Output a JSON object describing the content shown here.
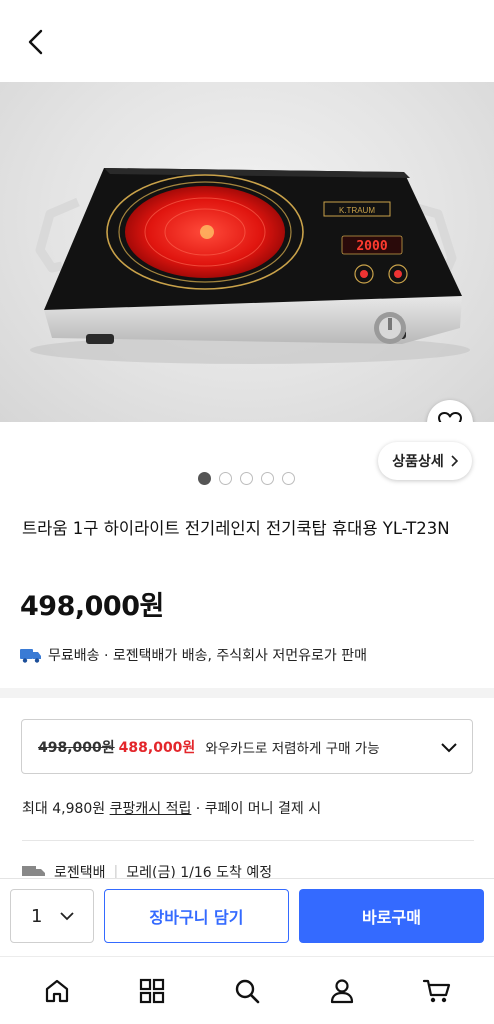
{
  "header": {
    "back_icon": "chevron-left-icon"
  },
  "product": {
    "image_icon": "induction-cooktop-photo",
    "hob_display": "2000",
    "hob_brand": "K.TRAUM",
    "title": "트라움 1구 하이라이트 전기레인지 전기쿡탑 휴대용 YL-T23N",
    "price": "498,000원",
    "detail_button": "상품상세",
    "carousel": {
      "count": 5,
      "active": 0
    }
  },
  "shipping": {
    "icon": "truck-icon",
    "text": "무료배송 · 로젠택배가 배송, 주식회사 저먼유로가 판매"
  },
  "card_offer": {
    "original_price": "498,000원",
    "sale_price": "488,000원",
    "text": "와우카드로 저렴하게 구매 가능"
  },
  "cashback": {
    "prefix": "최대 4,980원 ",
    "link": "쿠팡캐시 적립",
    "suffix": " · 쿠페이 머니 결제 시"
  },
  "delivery": {
    "carrier": "로젠택배",
    "eta": "모레(금) 1/16 도착 예정"
  },
  "buy_bar": {
    "quantity": "1",
    "cart_label": "장바구니 담기",
    "buy_label": "바로구매"
  },
  "tabs": [
    "home-icon",
    "grid-icon",
    "search-icon",
    "user-icon",
    "cart-icon"
  ],
  "colors": {
    "accent": "#346aff",
    "sale": "#e3262b"
  }
}
